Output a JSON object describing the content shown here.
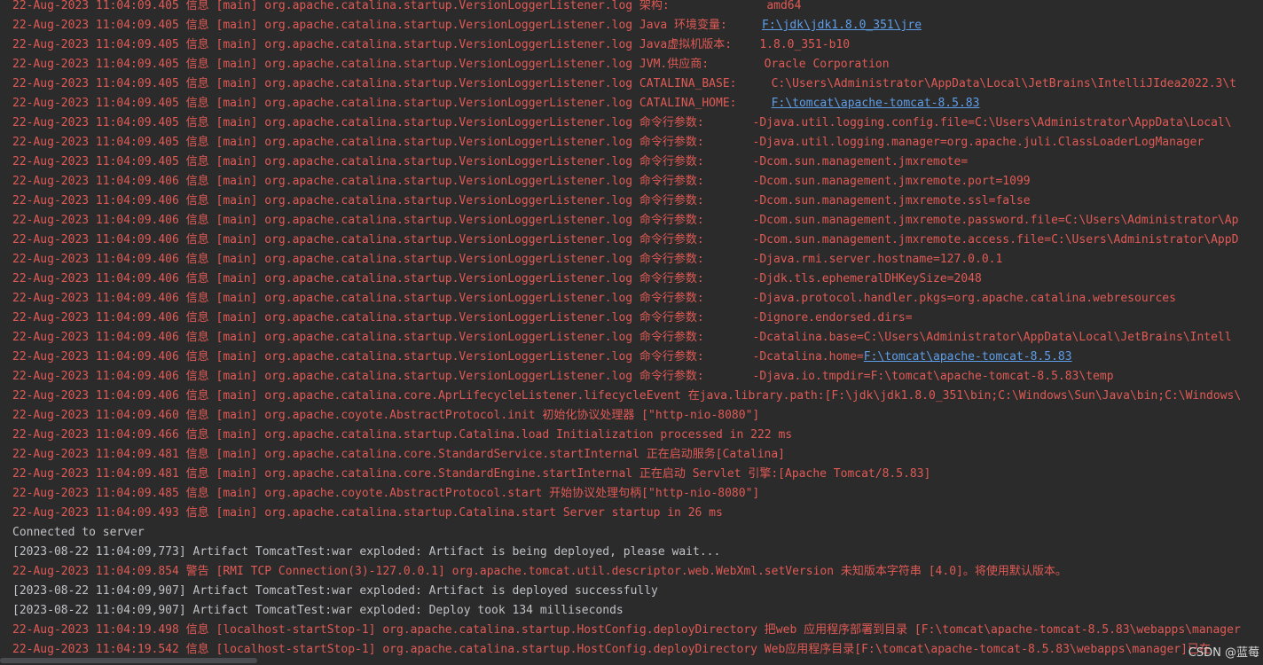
{
  "console": {
    "lines": [
      {
        "style": "red",
        "segments": [
          {
            "text": "22-Aug-2023 11:04:09.405 信息 [main] org.apache.catalina.startup.VersionLoggerListener.log 架构:              amd64"
          }
        ]
      },
      {
        "style": "red",
        "segments": [
          {
            "text": "22-Aug-2023 11:04:09.405 信息 [main] org.apache.catalina.startup.VersionLoggerListener.log Java 环境变量:     "
          },
          {
            "text": "F:\\jdk\\jdk1.8.0_351\\jre",
            "link": true
          }
        ]
      },
      {
        "style": "red",
        "segments": [
          {
            "text": "22-Aug-2023 11:04:09.405 信息 [main] org.apache.catalina.startup.VersionLoggerListener.log Java虚拟机版本:    1.8.0_351-b10"
          }
        ]
      },
      {
        "style": "red",
        "segments": [
          {
            "text": "22-Aug-2023 11:04:09.405 信息 [main] org.apache.catalina.startup.VersionLoggerListener.log JVM.供应商:        Oracle Corporation"
          }
        ]
      },
      {
        "style": "red",
        "segments": [
          {
            "text": "22-Aug-2023 11:04:09.405 信息 [main] org.apache.catalina.startup.VersionLoggerListener.log CATALINA_BASE:     C:\\Users\\Administrator\\AppData\\Local\\JetBrains\\IntelliJIdea2022.3\\t"
          }
        ]
      },
      {
        "style": "red",
        "segments": [
          {
            "text": "22-Aug-2023 11:04:09.405 信息 [main] org.apache.catalina.startup.VersionLoggerListener.log CATALINA_HOME:     "
          },
          {
            "text": "F:\\tomcat\\apache-tomcat-8.5.83",
            "link": true
          }
        ]
      },
      {
        "style": "red",
        "segments": [
          {
            "text": "22-Aug-2023 11:04:09.405 信息 [main] org.apache.catalina.startup.VersionLoggerListener.log 命令行参数:       -Djava.util.logging.config.file=C:\\Users\\Administrator\\AppData\\Local\\"
          }
        ]
      },
      {
        "style": "red",
        "segments": [
          {
            "text": "22-Aug-2023 11:04:09.405 信息 [main] org.apache.catalina.startup.VersionLoggerListener.log 命令行参数:       -Djava.util.logging.manager=org.apache.juli.ClassLoaderLogManager"
          }
        ]
      },
      {
        "style": "red",
        "segments": [
          {
            "text": "22-Aug-2023 11:04:09.405 信息 [main] org.apache.catalina.startup.VersionLoggerListener.log 命令行参数:       -Dcom.sun.management.jmxremote="
          }
        ]
      },
      {
        "style": "red",
        "segments": [
          {
            "text": "22-Aug-2023 11:04:09.406 信息 [main] org.apache.catalina.startup.VersionLoggerListener.log 命令行参数:       -Dcom.sun.management.jmxremote.port=1099"
          }
        ]
      },
      {
        "style": "red",
        "segments": [
          {
            "text": "22-Aug-2023 11:04:09.406 信息 [main] org.apache.catalina.startup.VersionLoggerListener.log 命令行参数:       -Dcom.sun.management.jmxremote.ssl=false"
          }
        ]
      },
      {
        "style": "red",
        "segments": [
          {
            "text": "22-Aug-2023 11:04:09.406 信息 [main] org.apache.catalina.startup.VersionLoggerListener.log 命令行参数:       -Dcom.sun.management.jmxremote.password.file=C:\\Users\\Administrator\\Ap"
          }
        ]
      },
      {
        "style": "red",
        "segments": [
          {
            "text": "22-Aug-2023 11:04:09.406 信息 [main] org.apache.catalina.startup.VersionLoggerListener.log 命令行参数:       -Dcom.sun.management.jmxremote.access.file=C:\\Users\\Administrator\\AppD"
          }
        ]
      },
      {
        "style": "red",
        "segments": [
          {
            "text": "22-Aug-2023 11:04:09.406 信息 [main] org.apache.catalina.startup.VersionLoggerListener.log 命令行参数:       -Djava.rmi.server.hostname=127.0.0.1"
          }
        ]
      },
      {
        "style": "red",
        "segments": [
          {
            "text": "22-Aug-2023 11:04:09.406 信息 [main] org.apache.catalina.startup.VersionLoggerListener.log 命令行参数:       -Djdk.tls.ephemeralDHKeySize=2048"
          }
        ]
      },
      {
        "style": "red",
        "segments": [
          {
            "text": "22-Aug-2023 11:04:09.406 信息 [main] org.apache.catalina.startup.VersionLoggerListener.log 命令行参数:       -Djava.protocol.handler.pkgs=org.apache.catalina.webresources"
          }
        ]
      },
      {
        "style": "red",
        "segments": [
          {
            "text": "22-Aug-2023 11:04:09.406 信息 [main] org.apache.catalina.startup.VersionLoggerListener.log 命令行参数:       -Dignore.endorsed.dirs="
          }
        ]
      },
      {
        "style": "red",
        "segments": [
          {
            "text": "22-Aug-2023 11:04:09.406 信息 [main] org.apache.catalina.startup.VersionLoggerListener.log 命令行参数:       -Dcatalina.base=C:\\Users\\Administrator\\AppData\\Local\\JetBrains\\Intell"
          }
        ]
      },
      {
        "style": "red",
        "segments": [
          {
            "text": "22-Aug-2023 11:04:09.406 信息 [main] org.apache.catalina.startup.VersionLoggerListener.log 命令行参数:       -Dcatalina.home="
          },
          {
            "text": "F:\\tomcat\\apache-tomcat-8.5.83",
            "link": true
          }
        ]
      },
      {
        "style": "red",
        "segments": [
          {
            "text": "22-Aug-2023 11:04:09.406 信息 [main] org.apache.catalina.startup.VersionLoggerListener.log 命令行参数:       -Djava.io.tmpdir=F:\\tomcat\\apache-tomcat-8.5.83\\temp"
          }
        ]
      },
      {
        "style": "red",
        "segments": [
          {
            "text": "22-Aug-2023 11:04:09.406 信息 [main] org.apache.catalina.core.AprLifecycleListener.lifecycleEvent 在java.library.path:[F:\\jdk\\jdk1.8.0_351\\bin;C:\\Windows\\Sun\\Java\\bin;C:\\Windows\\"
          }
        ]
      },
      {
        "style": "red",
        "segments": [
          {
            "text": "22-Aug-2023 11:04:09.460 信息 [main] org.apache.coyote.AbstractProtocol.init 初始化协议处理器 [\"http-nio-8080\"]"
          }
        ]
      },
      {
        "style": "red",
        "segments": [
          {
            "text": "22-Aug-2023 11:04:09.466 信息 [main] org.apache.catalina.startup.Catalina.load Initialization processed in 222 ms"
          }
        ]
      },
      {
        "style": "red",
        "segments": [
          {
            "text": "22-Aug-2023 11:04:09.481 信息 [main] org.apache.catalina.core.StandardService.startInternal 正在启动服务[Catalina]"
          }
        ]
      },
      {
        "style": "red",
        "segments": [
          {
            "text": "22-Aug-2023 11:04:09.481 信息 [main] org.apache.catalina.core.StandardEngine.startInternal 正在启动 Servlet 引擎:[Apache Tomcat/8.5.83]"
          }
        ]
      },
      {
        "style": "red",
        "segments": [
          {
            "text": "22-Aug-2023 11:04:09.485 信息 [main] org.apache.coyote.AbstractProtocol.start 开始协议处理句柄[\"http-nio-8080\"]"
          }
        ]
      },
      {
        "style": "red",
        "segments": [
          {
            "text": "22-Aug-2023 11:04:09.493 信息 [main] org.apache.catalina.startup.Catalina.start Server startup in 26 ms"
          }
        ]
      },
      {
        "style": "gray",
        "segments": [
          {
            "text": "Connected to server"
          }
        ]
      },
      {
        "style": "gray",
        "segments": [
          {
            "text": "[2023-08-22 11:04:09,773] Artifact TomcatTest:war exploded: Artifact is being deployed, please wait..."
          }
        ]
      },
      {
        "style": "red",
        "segments": [
          {
            "text": "22-Aug-2023 11:04:09.854 警告 [RMI TCP Connection(3)-127.0.0.1] org.apache.tomcat.util.descriptor.web.WebXml.setVersion 未知版本字符串 [4.0]。将使用默认版本。"
          }
        ]
      },
      {
        "style": "gray",
        "segments": [
          {
            "text": "[2023-08-22 11:04:09,907] Artifact TomcatTest:war exploded: Artifact is deployed successfully"
          }
        ]
      },
      {
        "style": "gray",
        "segments": [
          {
            "text": "[2023-08-22 11:04:09,907] Artifact TomcatTest:war exploded: Deploy took 134 milliseconds"
          }
        ]
      },
      {
        "style": "red",
        "segments": [
          {
            "text": "22-Aug-2023 11:04:19.498 信息 [localhost-startStop-1] org.apache.catalina.startup.HostConfig.deployDirectory 把web 应用程序部署到目录 [F:\\tomcat\\apache-tomcat-8.5.83\\webapps\\manager"
          }
        ]
      },
      {
        "style": "red",
        "segments": [
          {
            "text": "22-Aug-2023 11:04:19.542 信息 [localhost-startStop-1] org.apache.catalina.startup.HostConfig.deployDirectory Web应用程序目录[F:\\tomcat\\apache-tomcat-8.5.83\\webapps\\manager]已在"
          }
        ]
      }
    ]
  },
  "watermark": {
    "text": "CSDN @蓝莓"
  },
  "colors": {
    "background": "#2b2b2b",
    "log_red": "#e05a55",
    "plain_text": "#c0c2c6",
    "link_blue": "#5e9ee8"
  }
}
